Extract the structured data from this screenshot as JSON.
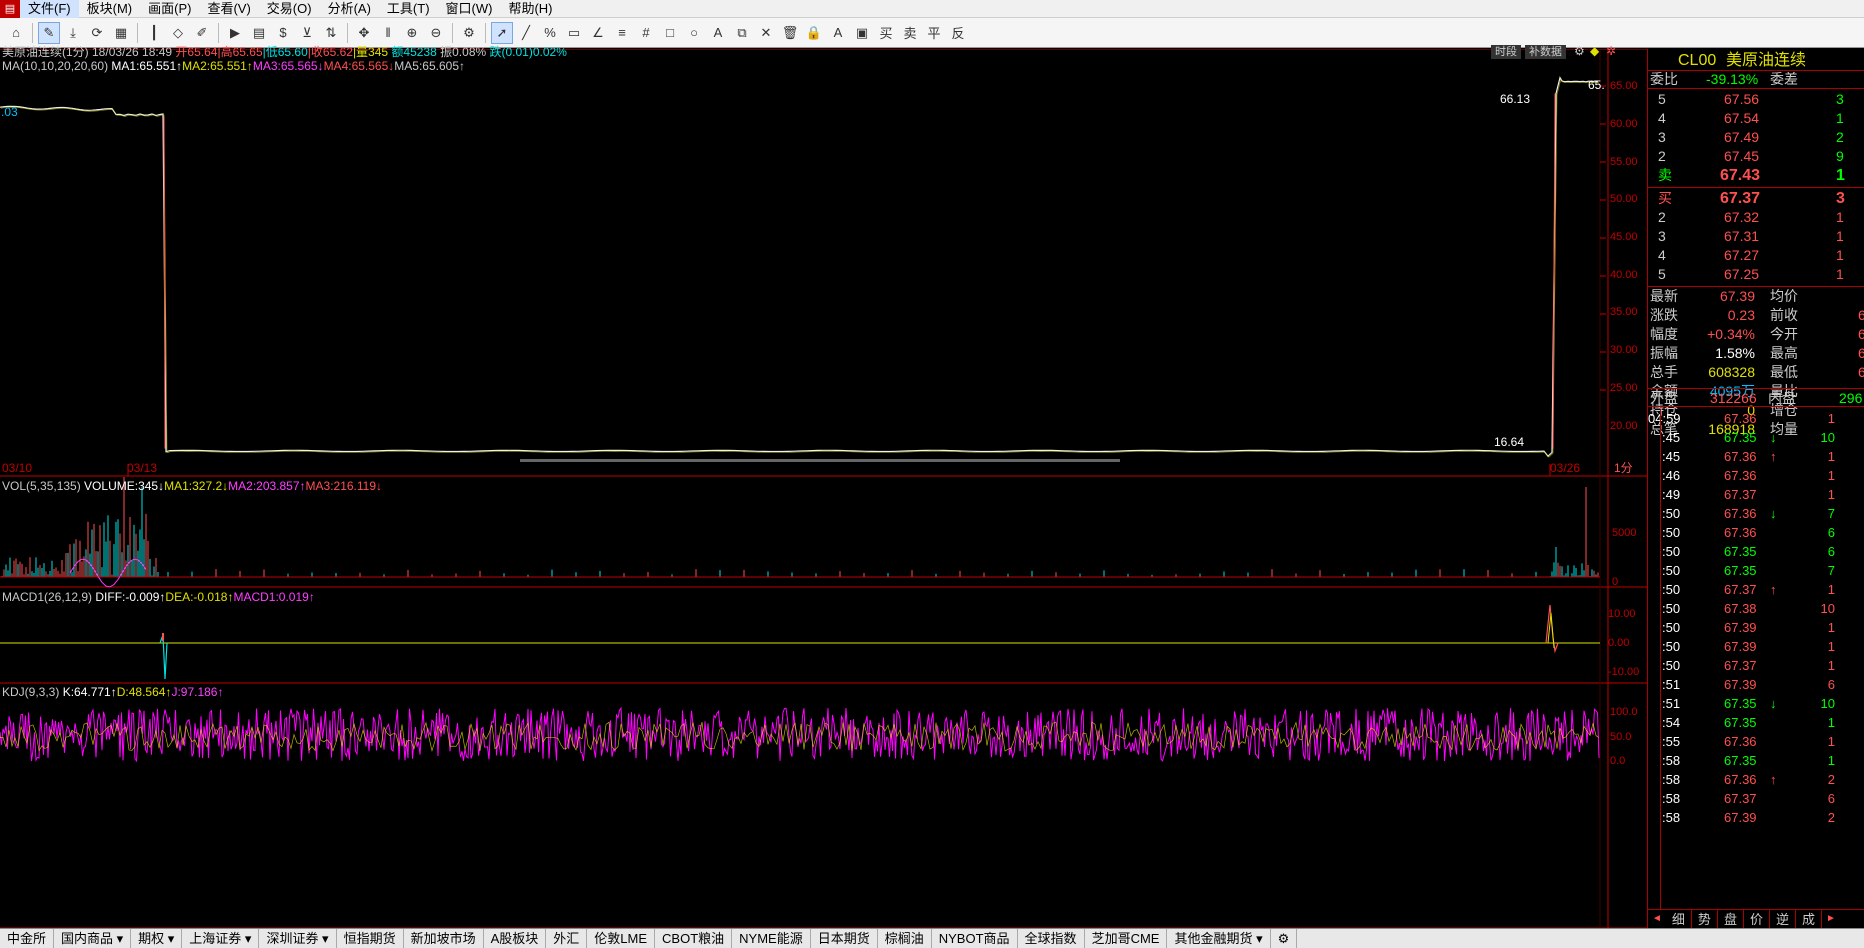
{
  "menu": {
    "items": [
      "文件(F)",
      "板块(M)",
      "画面(P)",
      "查看(V)",
      "交易(O)",
      "分析(A)",
      "工具(T)",
      "窗口(W)",
      "帮助(H)"
    ]
  },
  "chart": {
    "header_line1": [
      {
        "text": "美原油连续(1分)",
        "color": "#c8c8c8"
      },
      {
        "text": " 18/03/26 18:49",
        "color": "#c8c8c8"
      },
      {
        "text": " 开65.64",
        "color": "#ff5050"
      },
      {
        "text": "|高65.65",
        "color": "#ff5050"
      },
      {
        "text": "|低65.60",
        "color": "#00e0e0"
      },
      {
        "text": "|收65.62",
        "color": "#ff5050"
      },
      {
        "text": "|量345",
        "color": "#e0e000"
      },
      {
        "text": " 额45238",
        "color": "#00e0e0"
      },
      {
        "text": " 振0.08%",
        "color": "#c8c8c8"
      },
      {
        "text": " 跌(0.01)0.02%",
        "color": "#00e0e0"
      }
    ],
    "header_line2": [
      {
        "text": "MA(10,10,20,20,60)",
        "color": "#c8c8c8"
      },
      {
        "text": " MA1:65.551↑",
        "color": "#ffffff"
      },
      {
        "text": "MA2:65.551↑",
        "color": "#e0e000"
      },
      {
        "text": "MA3:65.565↓",
        "color": "#ff40ff"
      },
      {
        "text": "MA4:65.565↓",
        "color": "#ff5050"
      },
      {
        "text": "MA5:65.605↑",
        "color": "#c8c8c8"
      }
    ],
    "top_right_buttons": [
      "时段",
      "补数据"
    ],
    "price_axis": [
      "65.00",
      "60.00",
      "55.00",
      "50.00",
      "45.00",
      "40.00",
      "35.00",
      "30.00",
      "25.00",
      "20.00"
    ],
    "left_value": ".03",
    "high_label": "66.13",
    "low_label": "16.64",
    "partial_label": "65.",
    "date_axis": [
      "03/10",
      "03/13",
      "03/26"
    ],
    "period_label": "1分",
    "vol_header": [
      {
        "text": "VOL(5,35,135)",
        "color": "#c8c8c8"
      },
      {
        "text": " VOLUME:345↓",
        "color": "#ffffff"
      },
      {
        "text": "MA1:327.2↓",
        "color": "#e0e000"
      },
      {
        "text": "MA2:203.857↑",
        "color": "#ff40ff"
      },
      {
        "text": "MA3:216.119↓",
        "color": "#ff5050"
      }
    ],
    "vol_axis": [
      "5000",
      "0"
    ],
    "macd_header": [
      {
        "text": "MACD1(26,12,9)",
        "color": "#c8c8c8"
      },
      {
        "text": " DIFF:-0.009↑",
        "color": "#ffffff"
      },
      {
        "text": "DEA:-0.018↑",
        "color": "#e0e000"
      },
      {
        "text": "MACD1:0.019↑",
        "color": "#ff40ff"
      }
    ],
    "macd_axis": [
      "10.00",
      "0.00",
      "-10.00"
    ],
    "kdj_header": [
      {
        "text": "KDJ(9,3,3)",
        "color": "#c8c8c8"
      },
      {
        "text": " K:64.771↑",
        "color": "#ffffff"
      },
      {
        "text": "D:48.564↑",
        "color": "#e0e000"
      },
      {
        "text": "J:97.186↑",
        "color": "#ff40ff"
      }
    ],
    "kdj_axis": [
      "100.0",
      "50.0",
      "0.0"
    ]
  },
  "quote": {
    "code": "CL00",
    "name": "美原油连续",
    "weibi_label": "委比",
    "weibi_value": "-39.13%",
    "weicha_label": "委差",
    "asks": [
      {
        "lvl": "5",
        "price": "67.56",
        "vol": "3"
      },
      {
        "lvl": "4",
        "price": "67.54",
        "vol": "1"
      },
      {
        "lvl": "3",
        "price": "67.49",
        "vol": "2"
      },
      {
        "lvl": "2",
        "price": "67.45",
        "vol": "9"
      },
      {
        "lvl": "卖",
        "price": "67.43",
        "vol": "1"
      }
    ],
    "bids": [
      {
        "lvl": "买",
        "price": "67.37",
        "vol": "3"
      },
      {
        "lvl": "2",
        "price": "67.32",
        "vol": "1"
      },
      {
        "lvl": "3",
        "price": "67.31",
        "vol": "1"
      },
      {
        "lvl": "4",
        "price": "67.27",
        "vol": "1"
      },
      {
        "lvl": "5",
        "price": "67.25",
        "vol": "1"
      }
    ],
    "stats": [
      {
        "l": "最新",
        "v": "67.39",
        "vc": "#ff5050",
        "r": "均价",
        "rv": ""
      },
      {
        "l": "涨跌",
        "v": "0.23",
        "vc": "#ff5050",
        "r": "前收",
        "rv": "6"
      },
      {
        "l": "幅度",
        "v": "+0.34%",
        "vc": "#ff5050",
        "r": "今开",
        "rv": "6"
      },
      {
        "l": "振幅",
        "v": "1.58%",
        "vc": "#ffffff",
        "r": "最高",
        "rv": "6"
      },
      {
        "l": "总手",
        "v": "608328",
        "vc": "#e0e000",
        "r": "最低",
        "rv": "6"
      },
      {
        "l": "金额",
        "v": "4095万",
        "vc": "#00c0ff",
        "r": "量比",
        "rv": ""
      },
      {
        "l": "持仓",
        "v": "0",
        "vc": "#e0e000",
        "r": "增仓",
        "rv": ""
      },
      {
        "l": "总笔",
        "v": "168918",
        "vc": "#e0e000",
        "r": "均量",
        "rv": ""
      }
    ],
    "waipan_label": "外盘",
    "waipan_value": "312266",
    "neipan_label": "内盘",
    "neipan_value": "296",
    "ticks": [
      {
        "t": "04:59",
        "p": "67.36",
        "a": "",
        "v": "1",
        "vc": "#ff5050"
      },
      {
        "t": ":45",
        "p": "67.35",
        "a": "↓",
        "v": "10",
        "vc": "#00ff00"
      },
      {
        "t": ":45",
        "p": "67.36",
        "a": "↑",
        "v": "1",
        "vc": "#ff5050"
      },
      {
        "t": ":46",
        "p": "67.36",
        "a": "",
        "v": "1",
        "vc": "#ff5050"
      },
      {
        "t": ":49",
        "p": "67.37",
        "a": "",
        "v": "1",
        "vc": "#ff5050"
      },
      {
        "t": ":50",
        "p": "67.36",
        "a": "↓",
        "v": "7",
        "vc": "#00ff00"
      },
      {
        "t": ":50",
        "p": "67.36",
        "a": "",
        "v": "6",
        "vc": "#00ff00"
      },
      {
        "t": ":50",
        "p": "67.35",
        "a": "",
        "v": "6",
        "vc": "#00ff00"
      },
      {
        "t": ":50",
        "p": "67.35",
        "a": "",
        "v": "7",
        "vc": "#00ff00"
      },
      {
        "t": ":50",
        "p": "67.37",
        "a": "↑",
        "v": "1",
        "vc": "#ff5050"
      },
      {
        "t": ":50",
        "p": "67.38",
        "a": "",
        "v": "10",
        "vc": "#ff5050"
      },
      {
        "t": ":50",
        "p": "67.39",
        "a": "",
        "v": "1",
        "vc": "#ff5050"
      },
      {
        "t": ":50",
        "p": "67.39",
        "a": "",
        "v": "1",
        "vc": "#ff5050"
      },
      {
        "t": ":50",
        "p": "67.37",
        "a": "",
        "v": "1",
        "vc": "#ff5050"
      },
      {
        "t": ":51",
        "p": "67.39",
        "a": "",
        "v": "6",
        "vc": "#ff5050"
      },
      {
        "t": ":51",
        "p": "67.35",
        "a": "↓",
        "v": "10",
        "vc": "#00ff00"
      },
      {
        "t": ":54",
        "p": "67.35",
        "a": "",
        "v": "1",
        "vc": "#00ff00"
      },
      {
        "t": ":55",
        "p": "67.36",
        "a": "",
        "v": "1",
        "vc": "#ff5050"
      },
      {
        "t": ":58",
        "p": "67.35",
        "a": "",
        "v": "1",
        "vc": "#00ff00"
      },
      {
        "t": ":58",
        "p": "67.36",
        "a": "↑",
        "v": "2",
        "vc": "#ff5050"
      },
      {
        "t": ":58",
        "p": "67.37",
        "a": "",
        "v": "6",
        "vc": "#ff5050"
      },
      {
        "t": ":58",
        "p": "67.39",
        "a": "",
        "v": "2",
        "vc": "#ff5050"
      }
    ],
    "bottom_tabs": [
      "细",
      "势",
      "盘",
      "价",
      "逆",
      "成"
    ]
  },
  "bottom_tabs": [
    "中金所",
    "国内商品 ▾",
    "期权 ▾",
    "上海证券 ▾",
    "深圳证券 ▾",
    "恒指期货",
    "新加坡市场",
    "A股板块",
    "外汇",
    "伦敦LME",
    "CBOT粮油",
    "NYME能源",
    "日本期货",
    "棕榈油",
    "NYBOT商品",
    "全球指数",
    "芝加哥CME",
    "其他金融期货 ▾"
  ]
}
